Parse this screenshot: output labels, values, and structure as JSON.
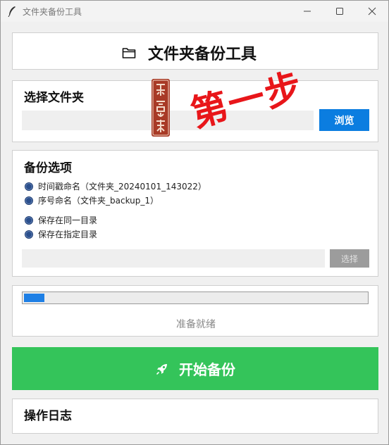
{
  "window": {
    "title": "文件夹备份工具"
  },
  "header": {
    "title": "文件夹备份工具",
    "icon": "folder-icon"
  },
  "folder_section": {
    "title": "选择文件夹",
    "input_value": "",
    "browse_label": "浏览"
  },
  "annotation": {
    "text": "第一步",
    "color": "#e8161a",
    "seal_text": "乐意梨"
  },
  "options_section": {
    "title": "备份选项",
    "naming_options": [
      "时间戳命名（文件夹_20240101_143022）",
      "序号命名（文件夹_backup_1）"
    ],
    "location_options": [
      "保存在同一目录",
      "保存在指定目录"
    ],
    "dir_input_value": "",
    "choose_label": "选择"
  },
  "progress": {
    "value": 0.06,
    "status": "准备就绪"
  },
  "start_button": {
    "label": "开始备份",
    "icon": "rocket-icon",
    "color": "#34c45a"
  },
  "log_section": {
    "title": "操作日志"
  },
  "colors": {
    "accent": "#0b7de0",
    "start": "#34c45a",
    "progress": "#1e7fe5"
  }
}
